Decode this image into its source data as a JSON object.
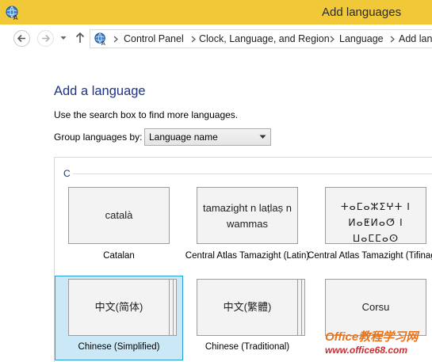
{
  "window": {
    "title": "Add languages",
    "icon": "language-globe-icon"
  },
  "nav": {
    "back_icon": "back-arrow-icon",
    "forward_icon": "forward-arrow-icon",
    "recent_icon": "chevron-down-icon",
    "up_icon": "up-arrow-icon",
    "breadcrumb": [
      "Control Panel",
      "Clock, Language, and Region",
      "Language",
      "Add lan"
    ]
  },
  "main": {
    "heading": "Add a language",
    "hint": "Use the search box to find more languages.",
    "group_by_label": "Group languages by:",
    "group_by_value": "Language name",
    "letter": "C"
  },
  "tiles": [
    {
      "native": "català",
      "name": "Catalan"
    },
    {
      "native": "tamazight n laṭlaṣ n wammas",
      "name": "Central Atlas Tamazight (Latin)"
    },
    {
      "native": "ⵜⴰⵎⴰⵣⵉⵖⵜ ⵏ ⵍⴰⵟⵍⴰⵚ ⵏ ⵡⴰⵎⵎⴰⵙ",
      "name": "Central Atlas Tamazight (Tifinagh)"
    },
    {
      "native": "中文(简体)",
      "name": "Chinese (Simplified)"
    },
    {
      "native": "中文(繁體)",
      "name": "Chinese (Traditional)"
    },
    {
      "native": "Corsu",
      "name": ""
    }
  ],
  "watermark": {
    "line1": "Office教程学习网",
    "line2": "www.office68.com"
  },
  "colors": {
    "titlebar": "#f0c838",
    "heading": "#1e3287",
    "selection": "#cbe8f6",
    "selection_border": "#26a0da"
  }
}
